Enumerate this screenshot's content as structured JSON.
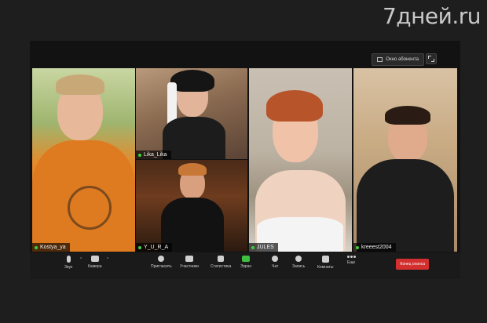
{
  "watermark": "7дней.ru",
  "window": {
    "view_label": "Окно абонента"
  },
  "participants": [
    {
      "name": "Kostya_ya"
    },
    {
      "name": "Lika_Lika"
    },
    {
      "name": "Y_U_R_A"
    },
    {
      "name": "JULES"
    },
    {
      "name": "kreeest2004"
    }
  ],
  "toolbar": {
    "audio": "Звук",
    "video": "Камера",
    "invite": "Пригласить",
    "participants": "Участники",
    "stats": "Статистика",
    "share": "Экран",
    "chat": "Чат",
    "record": "Запись",
    "rooms": "Комнаты",
    "more": "Еще",
    "end": "Конец сеанса"
  },
  "colors": {
    "background": "#1e1e1e",
    "window": "#121212",
    "mic_active": "#3ecf3e",
    "share_green": "#3fbf3f",
    "end_red": "#d32f2f"
  }
}
